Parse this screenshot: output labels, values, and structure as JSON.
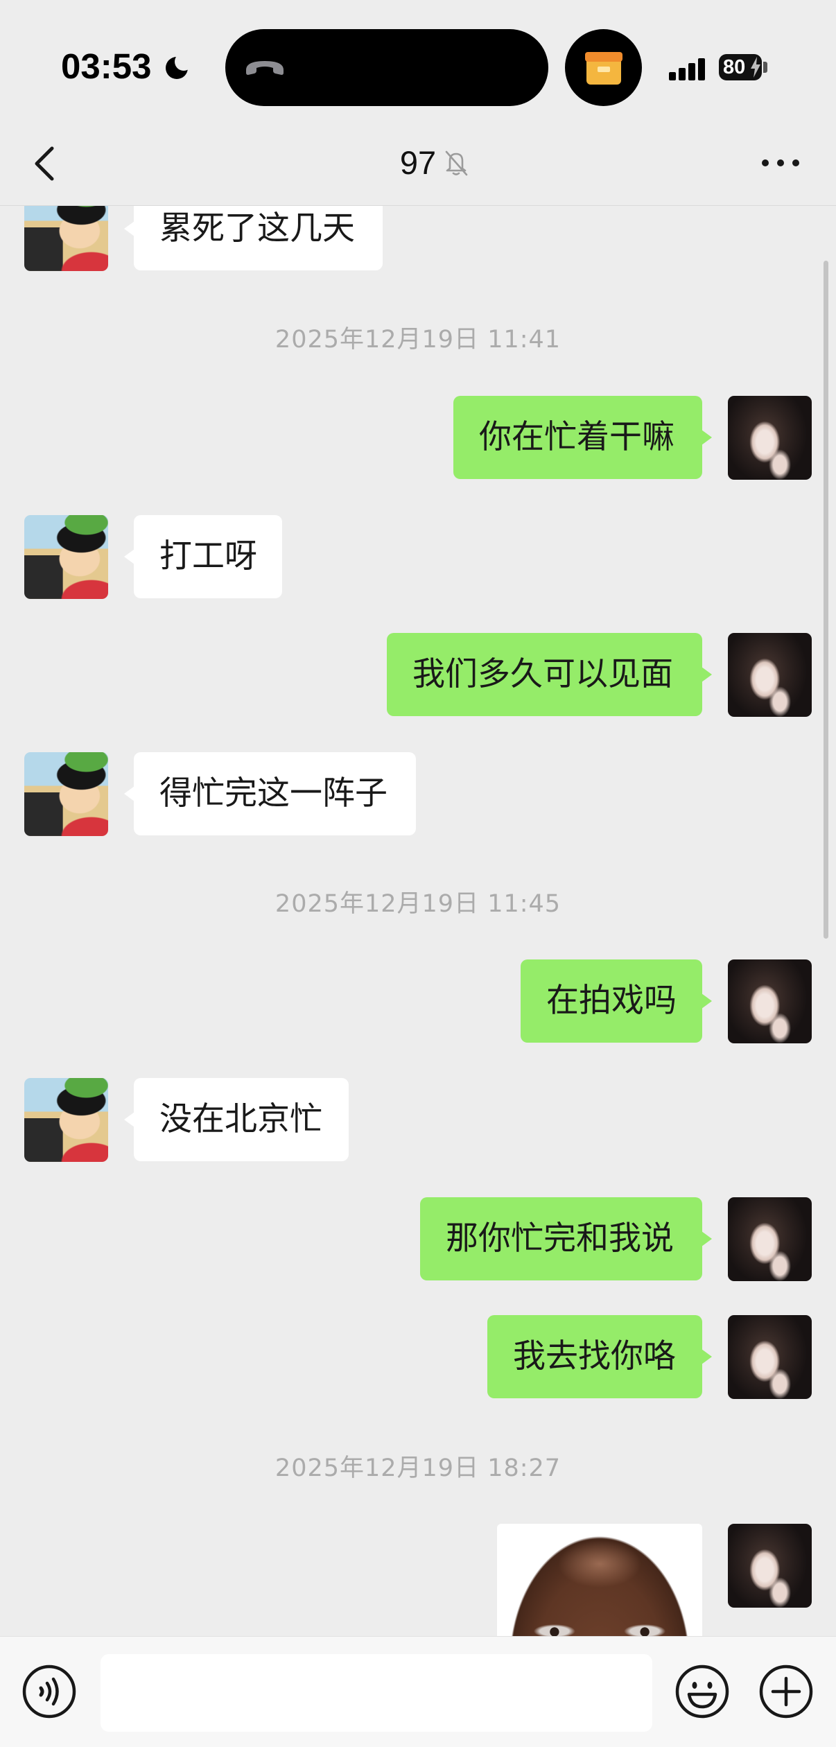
{
  "status_bar": {
    "time": "03:53",
    "battery_percent": "80",
    "charging": true,
    "signal_bars": 4,
    "focus_icon": "moon-icon",
    "call_icon": "phone-handset-icon",
    "live_activity_icon": "package-icon"
  },
  "nav_bar": {
    "title": "97",
    "muted": true,
    "back_icon": "chevron-left-icon",
    "mute_icon": "bell-slash-icon",
    "more_icon": "more-dots-icon"
  },
  "messages": [
    {
      "outgoing": false,
      "text": "累死了这几天"
    },
    {
      "timestamp": "2025年12月19日 11:41"
    },
    {
      "outgoing": true,
      "text": "你在忙着干嘛"
    },
    {
      "outgoing": false,
      "text": "打工呀"
    },
    {
      "outgoing": true,
      "text": "我们多久可以见面"
    },
    {
      "outgoing": false,
      "text": "得忙完这一阵子"
    },
    {
      "timestamp": "2025年12月19日 11:45"
    },
    {
      "outgoing": true,
      "text": "在拍戏吗"
    },
    {
      "outgoing": false,
      "text": "没在北京忙"
    },
    {
      "outgoing": true,
      "text": "那你忙完和我说"
    },
    {
      "outgoing": true,
      "text": "我去找你咯"
    },
    {
      "timestamp": "2025年12月19日 18:27"
    },
    {
      "outgoing": true,
      "image": true
    }
  ],
  "input_bar": {
    "value": "",
    "voice_icon": "voice-icon",
    "emoji_icon": "emoji-icon",
    "plus_icon": "plus-icon"
  },
  "colors": {
    "background": "#EDEDED",
    "outgoing_bubble": "#95EC69",
    "incoming_bubble": "#FFFFFF",
    "timestamp_text": "#ABABAB"
  }
}
